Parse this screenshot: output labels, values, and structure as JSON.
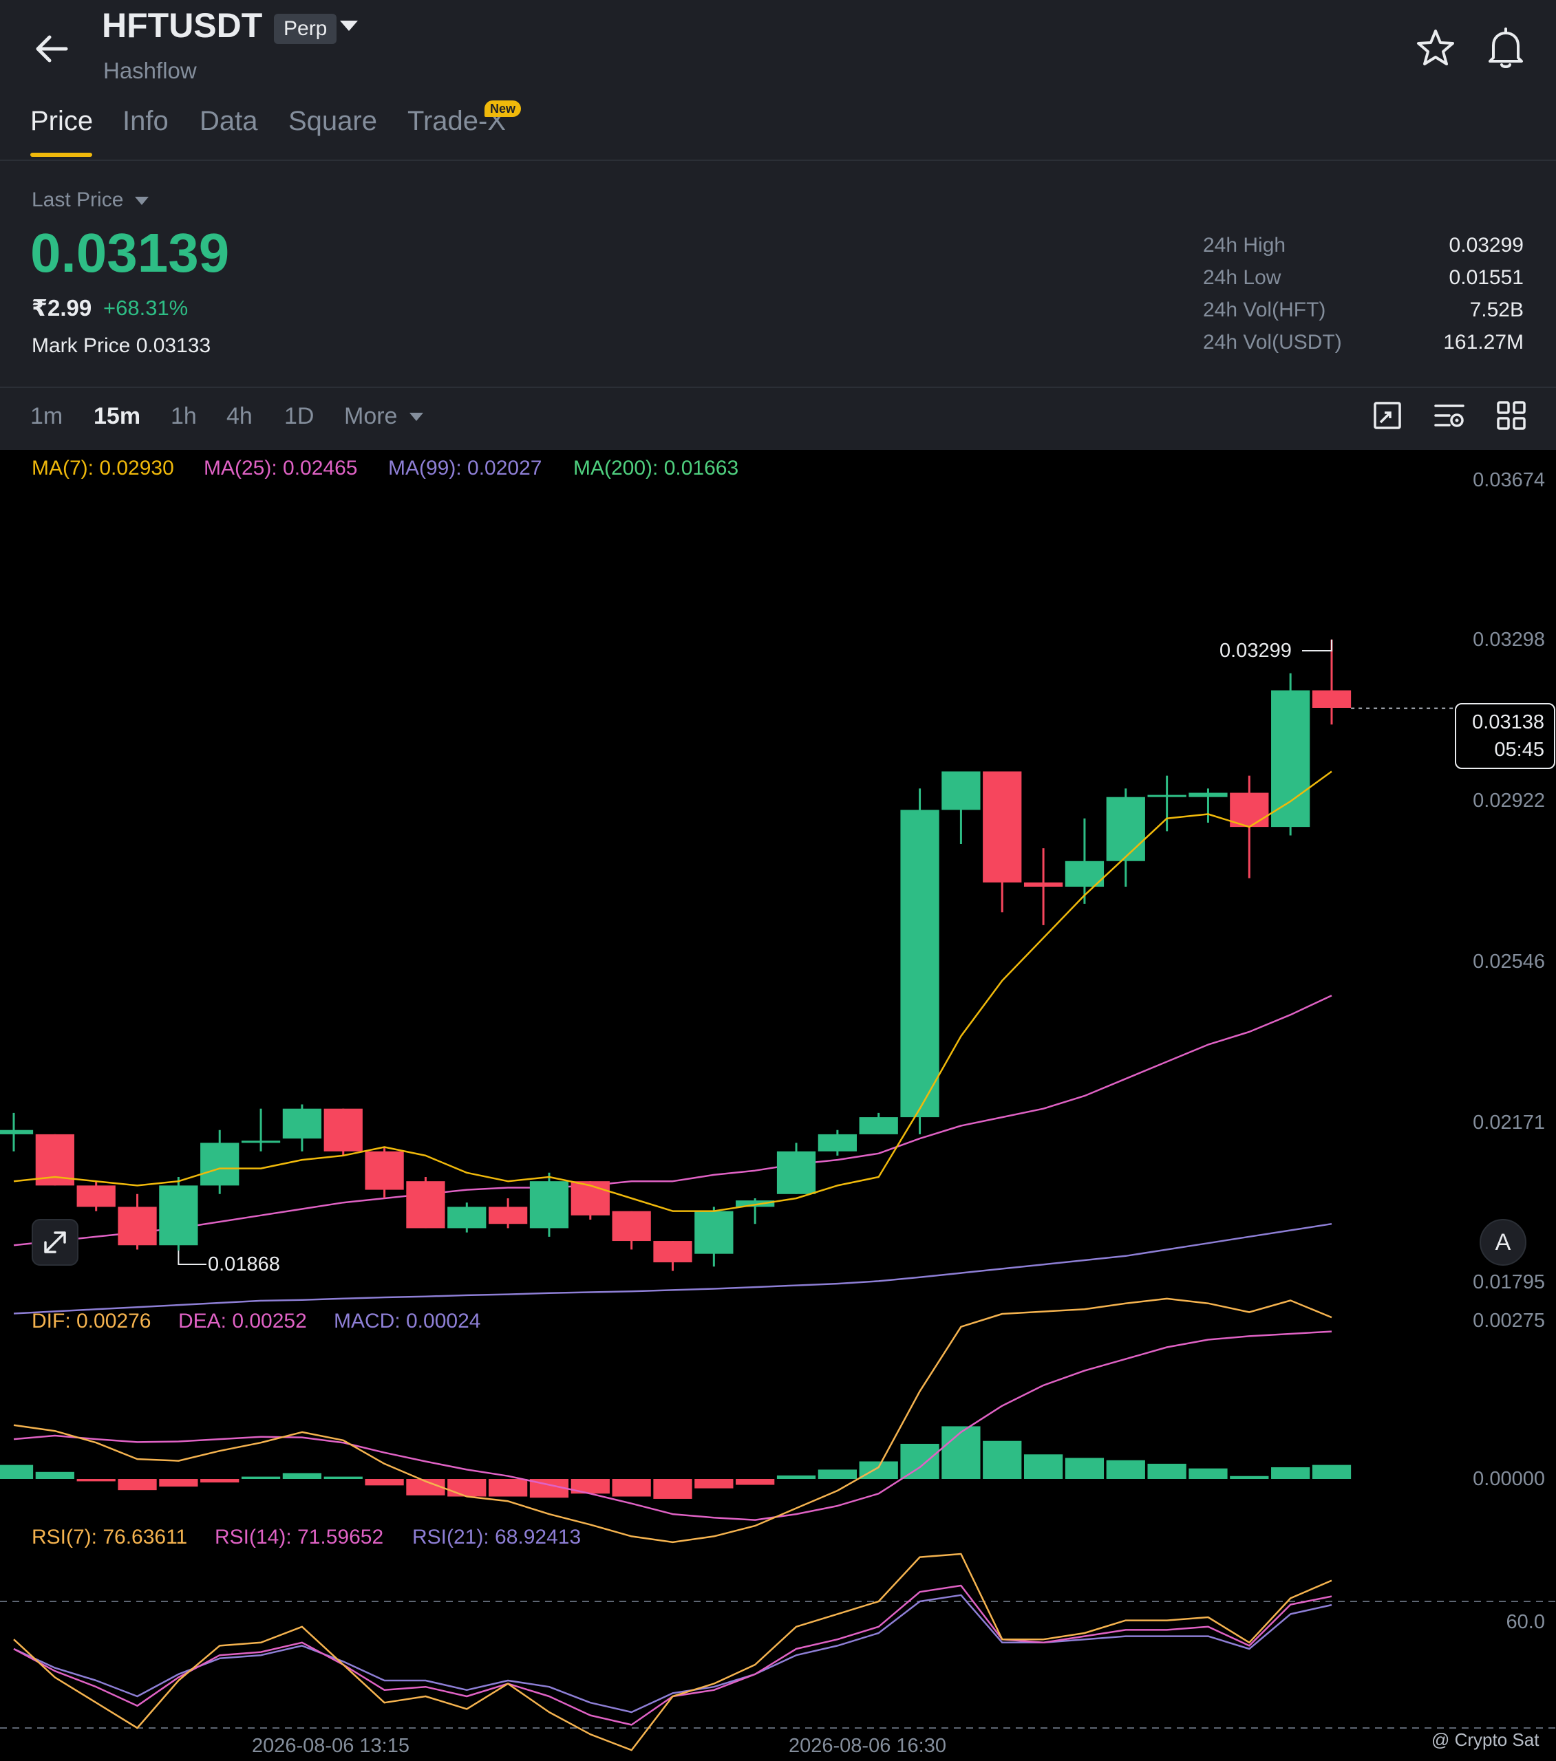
{
  "header": {
    "symbol": "HFTUSDT",
    "contract_badge": "Perp",
    "name": "Hashflow",
    "icons": {
      "back": "arrow-left-icon",
      "favorite": "star-icon",
      "alert": "bell-icon"
    }
  },
  "tabs": [
    {
      "label": "Price",
      "active": true
    },
    {
      "label": "Info"
    },
    {
      "label": "Data"
    },
    {
      "label": "Square"
    },
    {
      "label": "Trade-X",
      "badge": "New"
    }
  ],
  "ticker": {
    "price_type": "Last Price",
    "last_price": "0.03139",
    "fiat_price": "₹2.99",
    "change_pct": "+68.31%",
    "mark_label": "Mark Price",
    "mark_price": "0.03133",
    "stats": [
      {
        "label": "24h High",
        "value": "0.03299"
      },
      {
        "label": "24h Low",
        "value": "0.01551"
      },
      {
        "label": "24h Vol(HFT)",
        "value": "7.52B"
      },
      {
        "label": "24h Vol(USDT)",
        "value": "161.27M"
      }
    ]
  },
  "timeframes": {
    "options": [
      "1m",
      "15m",
      "1h",
      "4h",
      "1D"
    ],
    "active": "15m",
    "more_label": "More",
    "tool_icons": [
      "fullscreen-chart-icon",
      "indicator-settings-icon",
      "grid-layout-icon"
    ]
  },
  "colors": {
    "up": "#2ebd85",
    "down": "#f6465d",
    "ma7": "#f0b90b",
    "ma25": "#e062c5",
    "ma99": "#8e7fd6",
    "ma200": "#4fd07f",
    "dif": "#f5b34f",
    "dea": "#e062c5",
    "macd": "#8e7fd6"
  },
  "chart_labels": {
    "ma7": "MA(7): 0.02930",
    "ma25": "MA(25): 0.02465",
    "ma99": "MA(99): 0.02027",
    "ma200": "MA(200): 0.01663",
    "dif": "DIF: 0.00276",
    "dea": "DEA: 0.00252",
    "macd": "MACD: 0.00024",
    "rsi7": "RSI(7): 76.63611",
    "rsi14": "RSI(14): 71.59652",
    "rsi21": "RSI(21): 68.92413",
    "high_marker": "0.03299",
    "low_marker": "0.01868",
    "current_price": "0.03138",
    "countdown": "05:45",
    "auto_button": "A",
    "watermark": "@ Crypto Sat"
  },
  "chart_data": {
    "type": "candlestick",
    "interval": "15m",
    "price_axis_ticks": [
      "0.03674",
      "0.03298",
      "0.02922",
      "0.02546",
      "0.02171",
      "0.01795"
    ],
    "macd_axis_ticks": [
      "0.00275",
      "0.00000"
    ],
    "rsi_axis_ticks": [
      "60.0"
    ],
    "x_tick_labels": [
      "2026-08-06 13:15",
      "2026-08-06 16:30"
    ],
    "ohlc": [
      [
        0.0214,
        0.0219,
        0.021,
        0.0215
      ],
      [
        0.0214,
        0.0214,
        0.0202,
        0.0202
      ],
      [
        0.0202,
        0.0203,
        0.0196,
        0.0197
      ],
      [
        0.0197,
        0.02,
        0.0187,
        0.0188
      ],
      [
        0.0188,
        0.0204,
        0.01868,
        0.0202
      ],
      [
        0.0202,
        0.0215,
        0.02,
        0.0212
      ],
      [
        0.0212,
        0.022,
        0.021,
        0.02125
      ],
      [
        0.0213,
        0.0221,
        0.021,
        0.022
      ],
      [
        0.022,
        0.022,
        0.0209,
        0.021
      ],
      [
        0.021,
        0.0211,
        0.0199,
        0.0201
      ],
      [
        0.0203,
        0.0204,
        0.0192,
        0.0192
      ],
      [
        0.0192,
        0.0198,
        0.0191,
        0.0197
      ],
      [
        0.0197,
        0.0199,
        0.0192,
        0.0193
      ],
      [
        0.0192,
        0.0205,
        0.019,
        0.0203
      ],
      [
        0.0203,
        0.0203,
        0.0194,
        0.0195
      ],
      [
        0.0196,
        0.0196,
        0.0187,
        0.0189
      ],
      [
        0.0189,
        0.0189,
        0.0182,
        0.0184
      ],
      [
        0.0186,
        0.0197,
        0.0183,
        0.0196
      ],
      [
        0.0197,
        0.0199,
        0.0193,
        0.01985
      ],
      [
        0.02,
        0.0212,
        0.02,
        0.021
      ],
      [
        0.021,
        0.0215,
        0.0209,
        0.0214
      ],
      [
        0.0214,
        0.0219,
        0.0214,
        0.0218
      ],
      [
        0.0218,
        0.0295,
        0.0214,
        0.029
      ],
      [
        0.029,
        0.0298,
        0.0282,
        0.0299
      ],
      [
        0.0299,
        0.0299,
        0.0266,
        0.0273
      ],
      [
        0.0273,
        0.0281,
        0.0263,
        0.0272
      ],
      [
        0.0272,
        0.0288,
        0.0268,
        0.0278
      ],
      [
        0.0278,
        0.0295,
        0.0272,
        0.0293
      ],
      [
        0.0293,
        0.0298,
        0.0285,
        0.02935
      ],
      [
        0.0293,
        0.0295,
        0.0287,
        0.0294
      ],
      [
        0.0294,
        0.0298,
        0.0274,
        0.0286
      ],
      [
        0.0286,
        0.0322,
        0.0284,
        0.0318
      ],
      [
        0.0318,
        0.03299,
        0.031,
        0.03139
      ]
    ],
    "ma7_line": [
      0.0203,
      0.0204,
      0.0203,
      0.0202,
      0.0203,
      0.0206,
      0.0206,
      0.0208,
      0.0209,
      0.0211,
      0.0209,
      0.0205,
      0.0203,
      0.0204,
      0.0202,
      0.0199,
      0.0196,
      0.0196,
      0.01975,
      0.0199,
      0.0202,
      0.0204,
      0.022,
      0.0237,
      0.025,
      0.026,
      0.027,
      0.0279,
      0.0288,
      0.0289,
      0.0286,
      0.0292,
      0.0299
    ],
    "ma25_line": [
      0.0188,
      0.0189,
      0.019,
      0.0191,
      0.0192,
      0.01935,
      0.0195,
      0.01965,
      0.0198,
      0.0199,
      0.02,
      0.0201,
      0.02015,
      0.02015,
      0.0202,
      0.0203,
      0.0203,
      0.02045,
      0.02055,
      0.0207,
      0.0208,
      0.02095,
      0.0213,
      0.0216,
      0.0218,
      0.022,
      0.0223,
      0.0227,
      0.0231,
      0.0235,
      0.0238,
      0.0242,
      0.02465
    ],
    "ma99_line": [
      0.0172,
      0.01725,
      0.0173,
      0.01735,
      0.0174,
      0.01745,
      0.0175,
      0.01752,
      0.01755,
      0.01758,
      0.0176,
      0.01763,
      0.01765,
      0.01768,
      0.0177,
      0.01772,
      0.01775,
      0.01778,
      0.01782,
      0.01786,
      0.0179,
      0.01796,
      0.01805,
      0.01815,
      0.01825,
      0.01835,
      0.01845,
      0.01855,
      0.0187,
      0.01885,
      0.019,
      0.01915,
      0.0193
    ],
    "macd_dif": [
      0.00092,
      0.00082,
      0.00062,
      0.00034,
      0.00031,
      0.00048,
      0.00062,
      0.0008,
      0.00066,
      0.00026,
      -4e-05,
      -0.0003,
      -0.00038,
      -0.0006,
      -0.00078,
      -0.00098,
      -0.00108,
      -0.00098,
      -0.0008,
      -0.0005,
      -0.0002,
      0.0002,
      0.0015,
      0.0026,
      0.00282,
      0.00286,
      0.0029,
      0.003,
      0.00308,
      0.003,
      0.00285,
      0.00305,
      0.00276
    ],
    "macd_dea": [
      0.00068,
      0.00074,
      0.00068,
      0.00063,
      0.00064,
      0.00068,
      0.00072,
      0.00071,
      0.00062,
      0.00045,
      0.0003,
      0.00016,
      5e-05,
      -0.0001,
      -0.00025,
      -0.00042,
      -0.0006,
      -0.00066,
      -0.0007,
      -0.0006,
      -0.00046,
      -0.00025,
      0.0002,
      0.0008,
      0.00125,
      0.0016,
      0.00185,
      0.00205,
      0.00225,
      0.00238,
      0.00244,
      0.00248,
      0.00252
    ],
    "macd_hist": [
      0.00024,
      0.00012,
      -4e-05,
      -0.00019,
      -0.00013,
      -6e-05,
      4e-05,
      0.0001,
      4e-05,
      -0.00011,
      -0.00028,
      -0.0003,
      -0.0003,
      -0.00032,
      -0.00025,
      -0.0003,
      -0.00034,
      -0.00016,
      -0.0001,
      6e-05,
      0.00016,
      0.0003,
      0.0006,
      0.0009,
      0.00065,
      0.00042,
      0.00036,
      0.00032,
      0.00026,
      0.00018,
      5e-05,
      0.0002,
      0.00024
    ],
    "rsi7": [
      58,
      46,
      38,
      30,
      45,
      56,
      57,
      62,
      50,
      38,
      40,
      36,
      44,
      35,
      28,
      23,
      40,
      44,
      50,
      62,
      66,
      70,
      84,
      85,
      58,
      58,
      60,
      64,
      64,
      65,
      57,
      71,
      76.6
    ],
    "rsi14": [
      55,
      48,
      43,
      37,
      46,
      53,
      54,
      57,
      50,
      42,
      43,
      40,
      44,
      40,
      34,
      31,
      40,
      42,
      47,
      55,
      58,
      62,
      73,
      75,
      58,
      57,
      59,
      61,
      61,
      62,
      56,
      69,
      71.6
    ],
    "rsi21": [
      55,
      49,
      45,
      40,
      47,
      52,
      53,
      56,
      51,
      45,
      45,
      42,
      45,
      43,
      38,
      35,
      41,
      43,
      47,
      53,
      56,
      60,
      70,
      72,
      57,
      57,
      58,
      59,
      59,
      59,
      55,
      66,
      68.9
    ],
    "rsi_reference_lines": [
      70,
      30
    ]
  }
}
